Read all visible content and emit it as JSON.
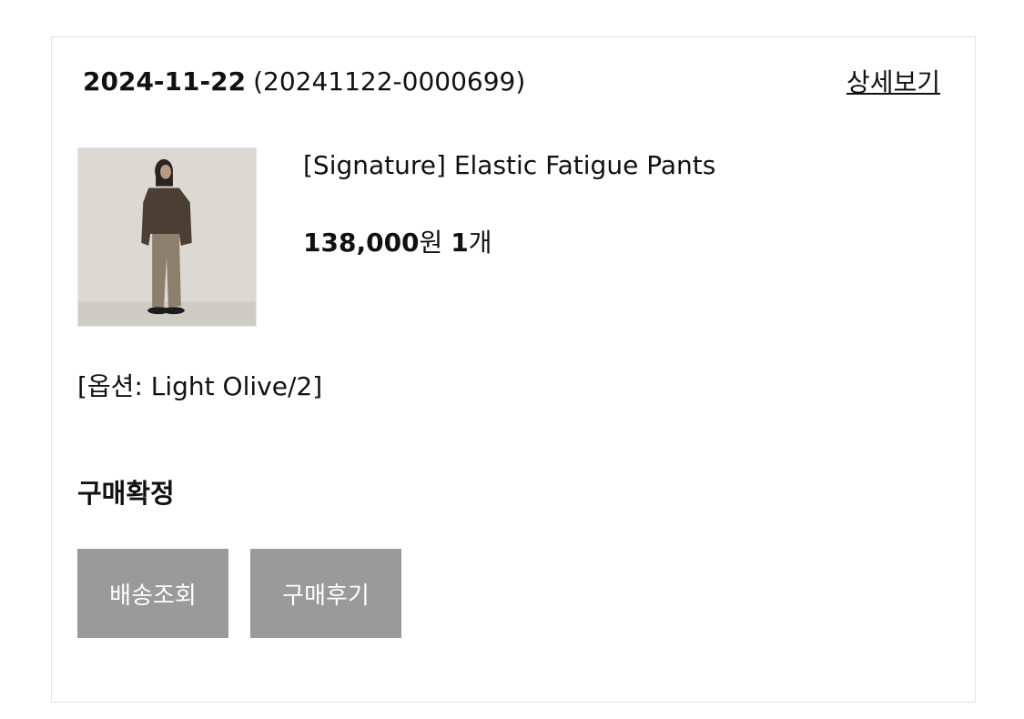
{
  "order": {
    "date": "2024-11-22",
    "number": "(20241122-0000699)",
    "detail_link": "상세보기"
  },
  "product": {
    "name": "[Signature] Elastic Fatigue Pants",
    "price": "138,000",
    "currency": "원",
    "quantity": "1",
    "quantity_unit": "개",
    "option": "[옵션: Light Olive/2]",
    "image_icon": "product-photo-model-icon"
  },
  "status": {
    "label": "구매확정"
  },
  "actions": {
    "track_label": "배송조회",
    "review_label": "구매후기"
  },
  "colors": {
    "button_bg": "#9a9a9a",
    "button_text": "#ffffff",
    "card_border": "#e3e3e3"
  }
}
